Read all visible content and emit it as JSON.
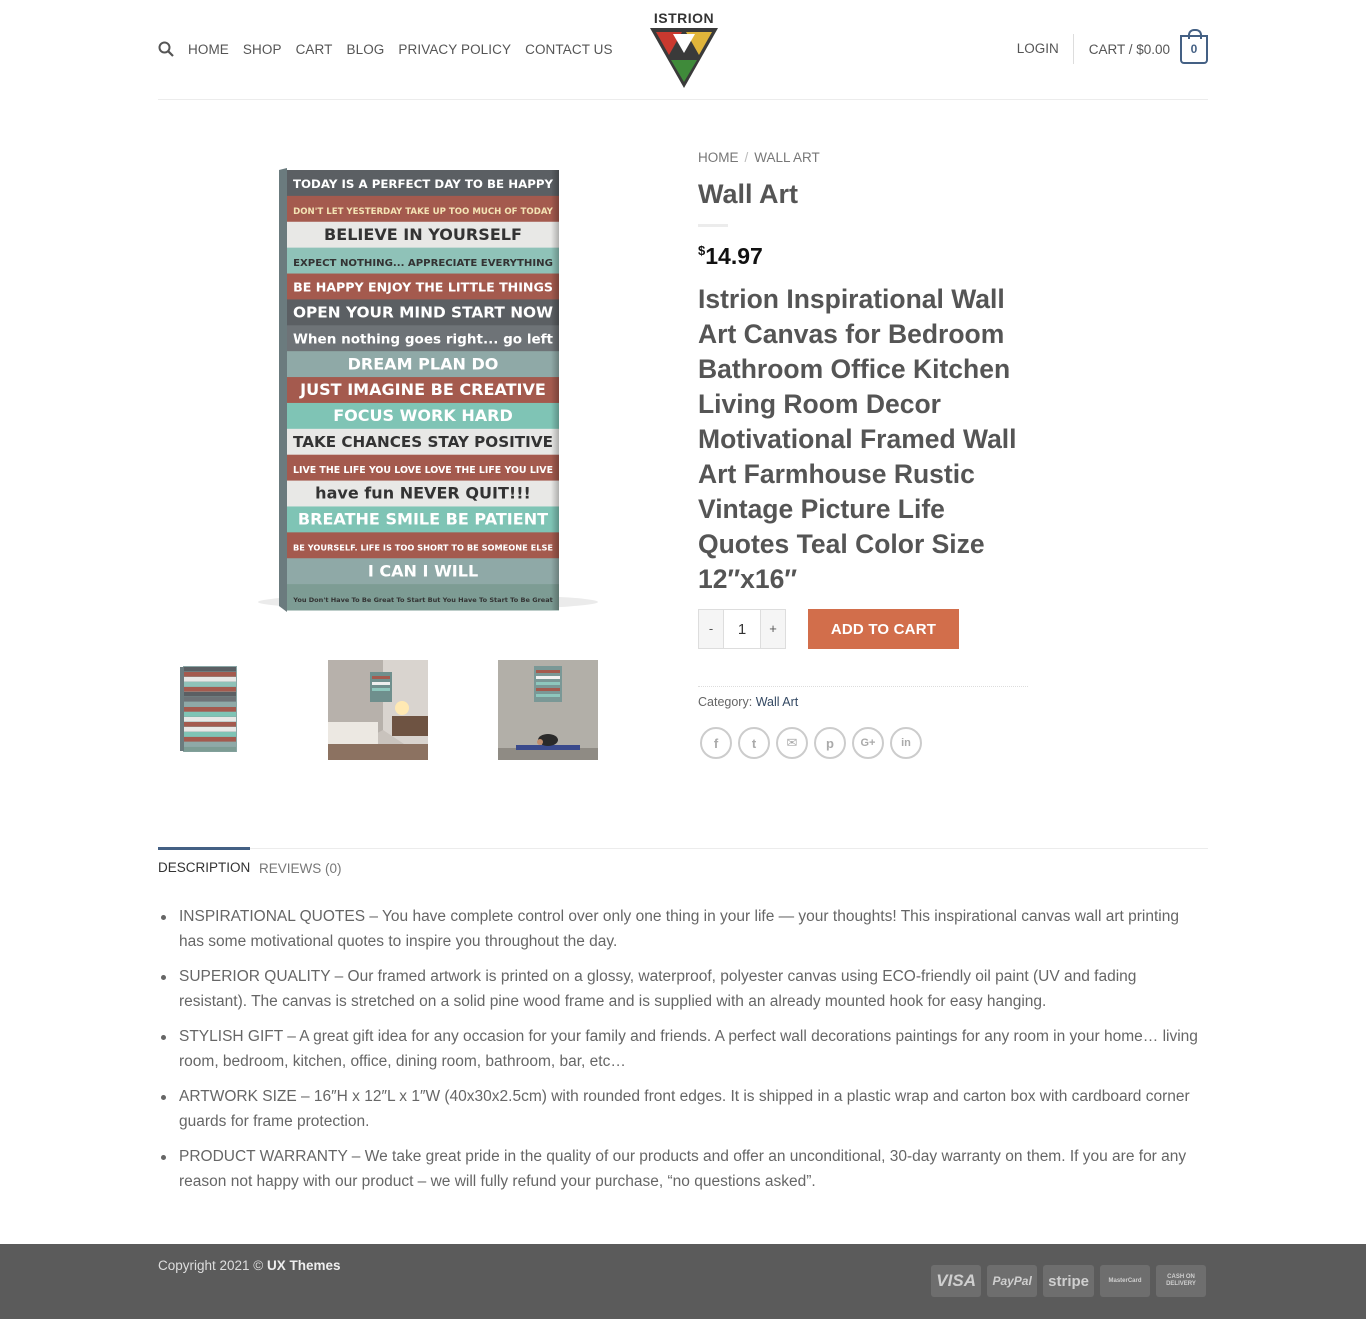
{
  "header": {
    "nav": [
      "HOME",
      "SHOP",
      "CART",
      "BLOG",
      "PRIVACY POLICY",
      "CONTACT US"
    ],
    "logo_text": "ISTRION",
    "login": "LOGIN",
    "cart_label": "CART / $0.00",
    "cart_count": "0"
  },
  "product": {
    "breadcrumb": [
      "HOME",
      "WALL ART"
    ],
    "breadcrumb_sep": "/",
    "title": "Wall Art",
    "price_currency": "$",
    "price_value": "14.97",
    "short_description": "Istrion Inspirational Wall Art Canvas for Bedroom Bathroom Office Kitchen Living Room Decor Motivational Framed Wall Art Farmhouse Rustic Vintage Picture Life Quotes Teal Color Size 12″x16″",
    "qty_minus": "-",
    "qty_value": "1",
    "qty_plus": "+",
    "add_to_cart": "ADD TO CART",
    "category_label": "Category:",
    "category_value": "Wall Art",
    "accent_color": "#d26e4b"
  },
  "canvas_quotes": [
    "TODAY IS A PERFECT DAY TO BE HAPPY",
    "DON'T LET YESTERDAY TAKE UP TOO MUCH OF TODAY",
    "BELIEVE IN YOURSELF",
    "EXPECT NOTHING... APPRECIATE EVERYTHING",
    "BE HAPPY   ENJOY THE LITTLE THINGS",
    "OPEN YOUR MIND   START NOW",
    "When nothing goes right... go left",
    "DREAM   PLAN   DO",
    "JUST IMAGINE   BE CREATIVE",
    "FOCUS   WORK HARD",
    "TAKE CHANCES   STAY POSITIVE",
    "LIVE THE LIFE YOU LOVE   LOVE THE LIFE YOU LIVE",
    "have fun   NEVER QUIT!!!",
    "BREATHE   SMILE   BE PATIENT",
    "BE YOURSELF. LIFE IS TOO SHORT TO BE SOMEONE ELSE",
    "I CAN   I WILL",
    "You Don't Have To Be Great To Start But You Have To Start To Be Great"
  ],
  "share_icons": [
    "facebook-icon",
    "twitter-icon",
    "email-icon",
    "pinterest-icon",
    "google-plus-icon",
    "linkedin-icon"
  ],
  "share_glyphs": [
    "f",
    "t",
    "✉",
    "p",
    "G+",
    "in"
  ],
  "tabs": [
    "DESCRIPTION",
    "REVIEWS (0)"
  ],
  "description": [
    "INSPIRATIONAL QUOTES – You have complete control over only one thing in your life — your thoughts! This inspirational canvas wall art printing has some motivational quotes to inspire you throughout the day.",
    "SUPERIOR QUALITY – Our framed artwork is printed on a glossy, waterproof, polyester canvas using ECO-friendly oil paint (UV and fading resistant). The canvas is stretched on a solid pine wood frame and is supplied with an already mounted hook for easy hanging.",
    "STYLISH GIFT – A great gift idea for any occasion for your family and friends. A perfect wall decorations paintings for any room in your home… living room, bedroom, kitchen, office, dining room, bathroom, bar, etc…",
    "ARTWORK SIZE – 16″H x 12″L x 1″W (40x30x2.5cm) with rounded front edges. It is shipped in a plastic wrap and carton box with cardboard corner guards for frame protection.",
    "PRODUCT WARRANTY – We take great pride in the quality of our products and offer an unconditional, 30-day warranty on them. If you are for any reason not happy with our product – we will fully refund your purchase, “no questions asked”."
  ],
  "footer": {
    "copyright_prefix": "Copyright 2021 ©",
    "copyright_brand": "UX Themes",
    "payments": [
      "VISA",
      "PayPal",
      "stripe",
      "MasterCard",
      "CASH ON DELIVERY"
    ]
  }
}
